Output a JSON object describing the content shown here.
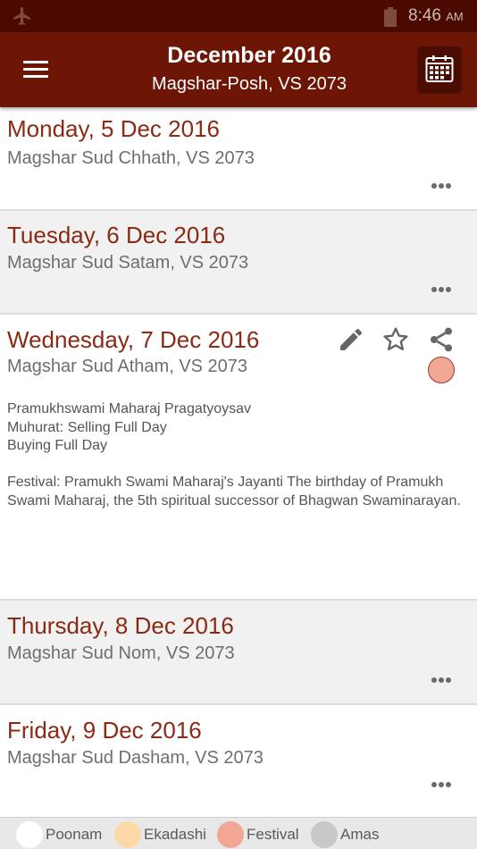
{
  "status_bar": {
    "time": "8:46",
    "ampm": "AM"
  },
  "header": {
    "title": "December 2016",
    "subtitle": "Magshar-Posh, VS 2073"
  },
  "days": [
    {
      "date": "Monday, 5 Dec 2016",
      "lunar": "Magshar Sud Chhath, VS 2073"
    },
    {
      "date": "Tuesday, 6 Dec 2016",
      "lunar": "Magshar Sud Satam, VS 2073"
    },
    {
      "date": "Wednesday, 7 Dec 2016",
      "lunar": "Magshar Sud Atham, VS 2073",
      "event_title": "Pramukhswami Maharaj Pragatyoysav",
      "muhurat_selling": "Muhurat: Selling Full Day",
      "muhurat_buying": "Buying Full Day",
      "festival_note": "Festival: Pramukh Swami Maharaj's Jayanti The birthday of Pramukh Swami Maharaj, the 5th spiritual successor of Bhagwan Swaminarayan."
    },
    {
      "date": "Thursday, 8 Dec 2016",
      "lunar": "Magshar Sud Nom, VS 2073"
    },
    {
      "date": "Friday, 9 Dec 2016",
      "lunar": "Magshar Sud Dasham, VS 2073"
    }
  ],
  "legend": [
    {
      "label": "Poonam",
      "color": "#ffffff"
    },
    {
      "label": "Ekadashi",
      "color": "#fdd9a8"
    },
    {
      "label": "Festival",
      "color": "#f2a794"
    },
    {
      "label": "Amas",
      "color": "#c8c8c8"
    }
  ],
  "colors": {
    "app_bar": "#6e1606",
    "status_bar": "#4a0a02",
    "date_text": "#8a2a14",
    "festival_marker": "#f2a794"
  }
}
